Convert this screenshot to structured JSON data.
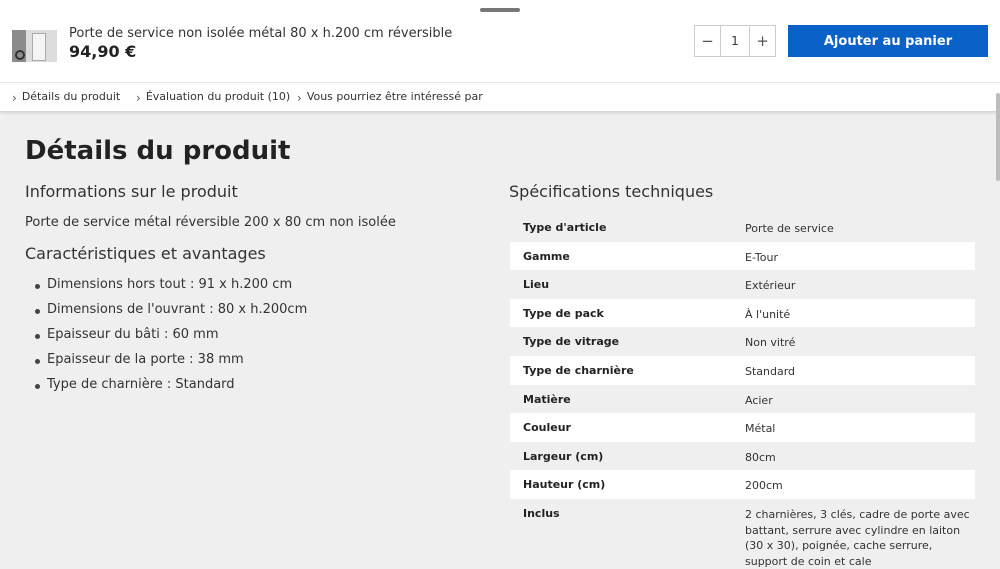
{
  "sticky_bar": {
    "product_title": "Porte de service non isolée métal 80 x h.200 cm réversible",
    "price": "94,90 €",
    "quantity": "1",
    "minus": "−",
    "plus": "+",
    "add_to_cart": "Ajouter au panier"
  },
  "subnav": {
    "items": [
      {
        "label": "Détails du produit"
      },
      {
        "label": "Évaluation du produit (10)"
      },
      {
        "label": "Vous pourriez être intéressé par"
      }
    ]
  },
  "main": {
    "title": "Détails du produit",
    "info_heading": "Informations sur le produit",
    "description": "Porte de service métal réversible 200 x 80 cm non isolée",
    "features_heading": "Caractéristiques et avantages",
    "features": [
      "Dimensions hors tout : 91 x h.200 cm",
      "Dimensions de l'ouvrant : 80 x h.200cm",
      "Epaisseur du bâti : 60 mm",
      "Epaisseur de la porte : 38 mm",
      "Type de charnière : Standard"
    ],
    "specs_heading": "Spécifications techniques",
    "specs": [
      {
        "label": "Type d'article",
        "value": "Porte de service"
      },
      {
        "label": "Gamme",
        "value": "E-Tour"
      },
      {
        "label": "Lieu",
        "value": "Extérieur"
      },
      {
        "label": "Type de pack",
        "value": "À l'unité"
      },
      {
        "label": "Type de vitrage",
        "value": "Non vitré"
      },
      {
        "label": "Type de charnière",
        "value": "Standard"
      },
      {
        "label": "Matière",
        "value": "Acier"
      },
      {
        "label": "Couleur",
        "value": "Métal"
      },
      {
        "label": "Largeur (cm)",
        "value": "80cm"
      },
      {
        "label": "Hauteur (cm)",
        "value": "200cm"
      },
      {
        "label": "Inclus",
        "value": "2 charnières, 3 clés, cadre de porte avec battant, serrure avec cylindre en laiton (30 x 30), poignée, cache serrure, support de coin et cale"
      }
    ]
  },
  "colors": {
    "accent": "#0a62c9",
    "background": "#efefef"
  },
  "icons": {
    "subnav_chevron": "chevron-right-icon"
  }
}
